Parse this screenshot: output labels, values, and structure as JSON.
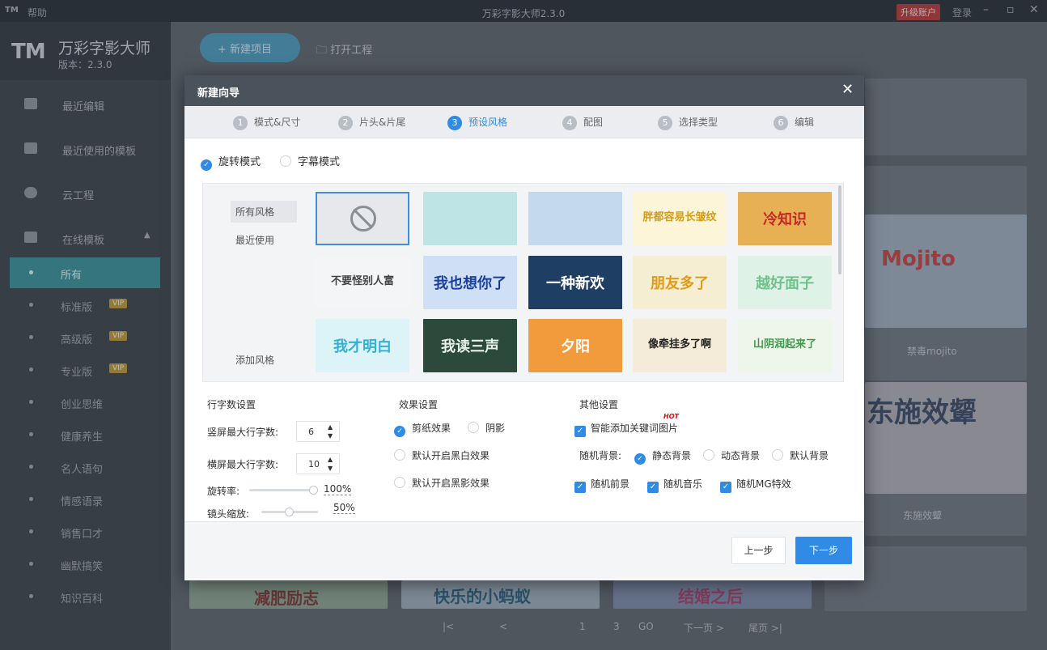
{
  "titlebar": {
    "logo_mini": "TM",
    "help": "帮助",
    "title": "万彩字影大师2.3.0",
    "upgrade": "升级账户",
    "login": "登录",
    "min": "–",
    "max": "▫",
    "close": "✕"
  },
  "brand": {
    "logo": "TM",
    "name": "万彩字影大师",
    "version": "版本：2.3.0"
  },
  "sidebar": {
    "items": [
      {
        "label": "最近编辑"
      },
      {
        "label": "最近使用的模板"
      },
      {
        "label": "云工程"
      },
      {
        "label": "在线模板"
      }
    ],
    "subitems": [
      {
        "label": "所有"
      },
      {
        "label": "标准版",
        "badge": "VIP"
      },
      {
        "label": "高级版",
        "badge": "VIP"
      },
      {
        "label": "专业版",
        "badge": "VIP"
      },
      {
        "label": "创业思维"
      },
      {
        "label": "健康养生"
      },
      {
        "label": "名人语句"
      },
      {
        "label": "情感语录"
      },
      {
        "label": "销售口才"
      },
      {
        "label": "幽默搞笑"
      },
      {
        "label": "知识百科"
      }
    ]
  },
  "main": {
    "new_project": "+ 新建项目",
    "open_project": "打开工程",
    "cards": [
      {
        "caption": "禁毒mojito",
        "title": "Mojito"
      },
      {
        "caption": "东施效颦",
        "title": "东施效颦"
      }
    ],
    "bottom_thumbs": [
      "减肥励志",
      "快乐的小蚂蚁",
      "结婚之后"
    ],
    "pager": {
      "first": "|<",
      "prev": "<",
      "page": "1",
      "page2": "3",
      "go": "GO",
      "next": "下一页 >",
      "last": "尾页 >|"
    }
  },
  "dialog": {
    "title": "新建向导",
    "close": "✕",
    "steps": [
      {
        "num": "1",
        "label": "模式&尺寸"
      },
      {
        "num": "2",
        "label": "片头&片尾"
      },
      {
        "num": "3",
        "label": "预设风格"
      },
      {
        "num": "4",
        "label": "配图"
      },
      {
        "num": "5",
        "label": "选择类型"
      },
      {
        "num": "6",
        "label": "编辑"
      }
    ],
    "active_step": 3,
    "modes": {
      "rotate": "旋转模式",
      "subtitle": "字幕模式"
    },
    "categories": {
      "all": "所有风格",
      "recent": "最近使用",
      "add": "添加风格"
    },
    "thumbs": [
      {
        "text": "",
        "bg": "#e7e8eb"
      },
      {
        "text": "",
        "bg": "#bfe4e6"
      },
      {
        "text": "",
        "bg": "#c5d9ee"
      },
      {
        "text": "胖都容易长皱纹",
        "bg": "#fdf5d8",
        "color": "#d49a1a"
      },
      {
        "text": "冷知识",
        "bg": "#e8b055",
        "color": "#c62828"
      },
      {
        "text": "不要怪别人富",
        "bg": "#f3f5f7",
        "color": "#444"
      },
      {
        "text": "我也想你了",
        "bg": "#cfe0f6",
        "color": "#1b3fa0"
      },
      {
        "text": "一种新欢",
        "bg": "#1f3e63",
        "color": "#ffffff"
      },
      {
        "text": "朋友多了",
        "bg": "#f6eed2",
        "color": "#e49a16"
      },
      {
        "text": "越好面子",
        "bg": "#dff2e8",
        "color": "#6fc28a"
      },
      {
        "text": "我才明白",
        "bg": "#dcf3f7",
        "color": "#34b0d6"
      },
      {
        "text": "我读三声",
        "bg": "#2c4a3c",
        "color": "#e6f0e8"
      },
      {
        "text": "夕阳",
        "bg": "#f29b3d",
        "color": "#ffffff"
      },
      {
        "text": "像牵挂多了啊",
        "bg": "#f4ecd8",
        "color": "#222"
      },
      {
        "text": "山阴润起来了",
        "bg": "#eef6ea",
        "color": "#3f9a4c"
      }
    ],
    "lines": {
      "title": "行字数设置",
      "portrait_label": "竖屏最大行字数:",
      "portrait_value": "6",
      "landscape_label": "横屏最大行字数:",
      "landscape_value": "10",
      "rotation_label": "旋转率:",
      "rotation_value": "100%",
      "rotation_level": 1.0,
      "zoom_label": "镜头缩放:",
      "zoom_value": "50%",
      "zoom_level": 0.5
    },
    "effects": {
      "title": "效果设置",
      "paper": "剪纸效果",
      "shadow": "阴影",
      "bw": "默认开启黑白效果",
      "black_shadow": "默认开启黑影效果"
    },
    "others": {
      "title": "其他设置",
      "hot": "HOT",
      "smart_img": "智能添加关键词图片",
      "bg_label": "随机背景:",
      "bg_static": "静态背景",
      "bg_dynamic": "动态背景",
      "bg_default": "默认背景",
      "rand_fg": "随机前景",
      "rand_music": "随机音乐",
      "rand_mg": "随机MG特效"
    },
    "buttons": {
      "prev": "上一步",
      "next": "下一步"
    }
  },
  "colors": {
    "accent": "#2f8be6",
    "sidebar_active": "#3a8f97",
    "header": "#4a525b"
  }
}
